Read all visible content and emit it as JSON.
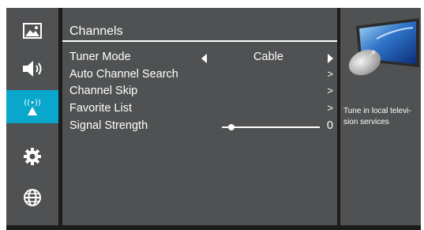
{
  "sidebar": {
    "items": [
      {
        "icon": "picture-icon",
        "active": false
      },
      {
        "icon": "speaker-icon",
        "active": false
      },
      {
        "icon": "broadcast-antenna-icon",
        "active": true
      },
      {
        "icon": "gear-icon",
        "active": false
      },
      {
        "icon": "globe-icon",
        "active": false
      }
    ]
  },
  "panel": {
    "title": "Channels",
    "rows": [
      {
        "label": "Tuner Mode",
        "value": "Cable"
      },
      {
        "label": "Auto Channel Search",
        "chevron": ">"
      },
      {
        "label": "Channel Skip",
        "chevron": ">"
      },
      {
        "label": "Favorite List",
        "chevron": ">"
      },
      {
        "label": "Signal Strength",
        "value": "0"
      }
    ]
  },
  "info": {
    "description": "Tune in local televi- sion services"
  },
  "colors": {
    "panel_bg": "#4f5152",
    "accent": "#0aa7cc",
    "background": "#1c1c1c"
  }
}
